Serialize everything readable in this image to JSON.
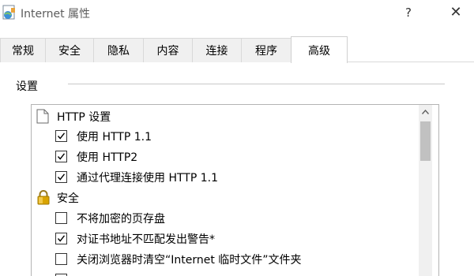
{
  "window": {
    "title": "Internet 属性",
    "help_glyph": "?",
    "close_glyph": "✕"
  },
  "tabs": [
    {
      "label": "常规",
      "active": false
    },
    {
      "label": "安全",
      "active": false
    },
    {
      "label": "隐私",
      "active": false
    },
    {
      "label": "内容",
      "active": false
    },
    {
      "label": "连接",
      "active": false
    },
    {
      "label": "程序",
      "active": false
    },
    {
      "label": "高级",
      "active": true
    }
  ],
  "settings": {
    "group_label": "设置",
    "items": [
      {
        "type": "group",
        "icon": "document-icon",
        "label": "HTTP 设置"
      },
      {
        "type": "option",
        "checked": true,
        "label": "使用 HTTP 1.1"
      },
      {
        "type": "option",
        "checked": true,
        "label": "使用 HTTP2"
      },
      {
        "type": "option",
        "checked": true,
        "label": "通过代理连接使用 HTTP 1.1"
      },
      {
        "type": "group",
        "icon": "lock-icon",
        "label": "安全"
      },
      {
        "type": "option",
        "checked": false,
        "label": "不将加密的页存盘"
      },
      {
        "type": "option",
        "checked": true,
        "label": "对证书地址不匹配发出警告*"
      },
      {
        "type": "option",
        "checked": false,
        "label": "关闭浏览器时清空“Internet 临时文件”文件夹"
      }
    ]
  },
  "colors": {
    "accent_lock": "#d9a400",
    "tab_border": "#d9d9d9"
  }
}
